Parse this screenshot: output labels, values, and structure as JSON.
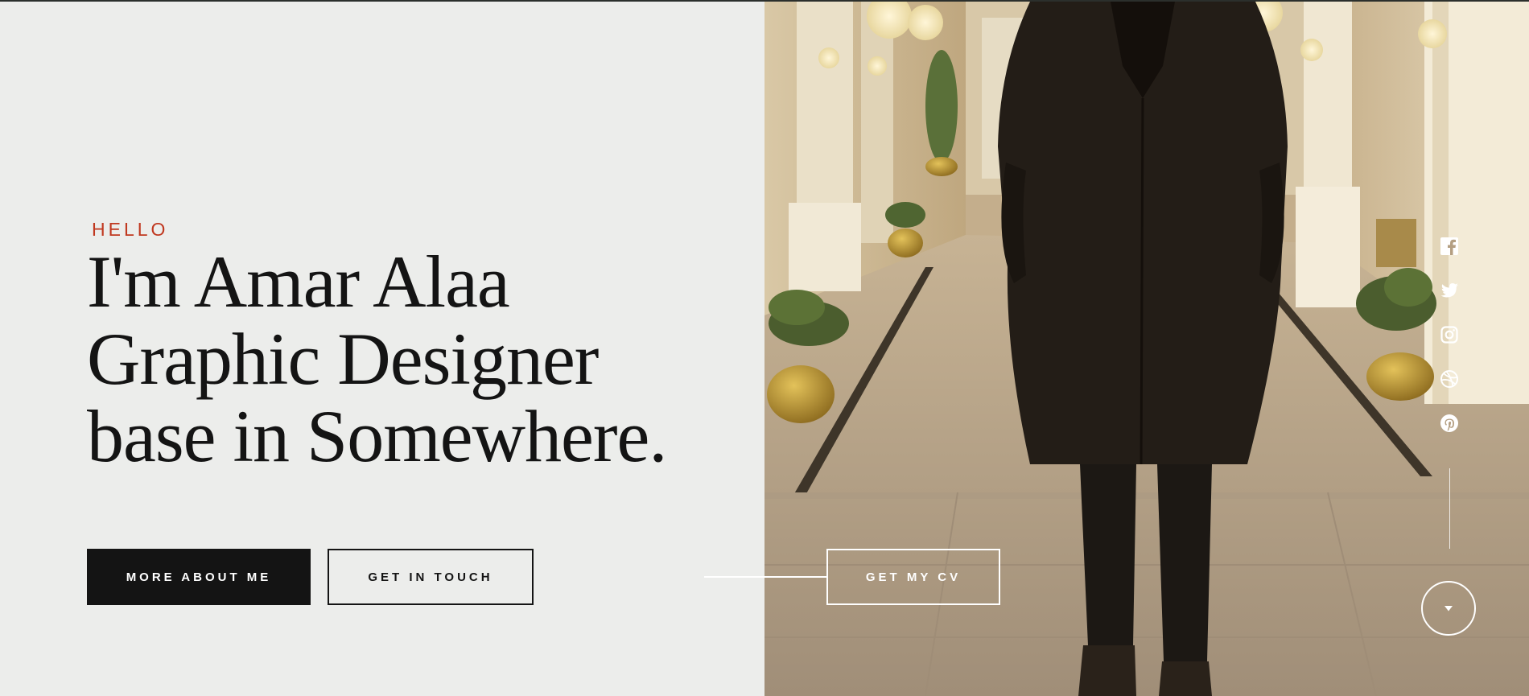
{
  "hero": {
    "eyebrow": "HELLO",
    "headline_lines": [
      "I'm Amar Alaa",
      "Graphic Designer",
      "base in Somewhere."
    ]
  },
  "buttons": {
    "more_about": "MORE ABOUT ME",
    "get_in_touch": "GET IN TOUCH",
    "get_cv": "GET MY CV"
  },
  "social": [
    {
      "name": "facebook-icon"
    },
    {
      "name": "twitter-icon"
    },
    {
      "name": "instagram-icon"
    },
    {
      "name": "dribbble-icon"
    },
    {
      "name": "pinterest-icon"
    }
  ],
  "scroll": {
    "icon": "caret-down-icon"
  },
  "colors": {
    "accent": "#c0381f",
    "text_dark": "#141414",
    "background": "#ecedeb",
    "on_photo": "#ffffff"
  }
}
